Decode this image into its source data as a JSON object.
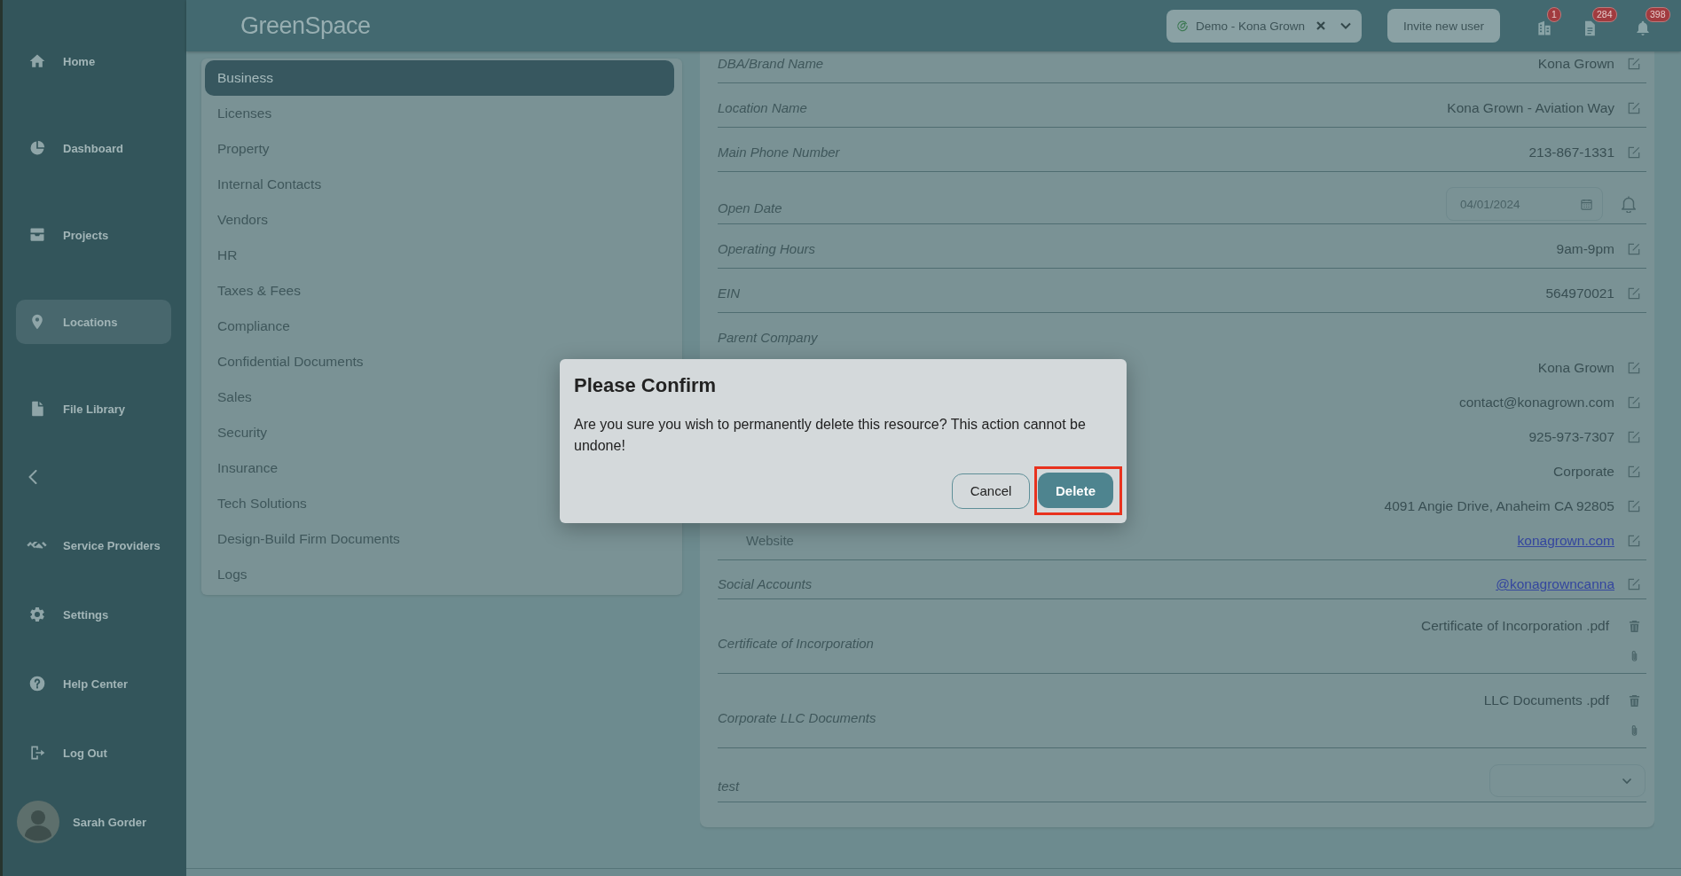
{
  "top_bar": {
    "logo": "GreenSpace",
    "account_selector": "Demo - Kona Grown",
    "invite_button": "Invite new user",
    "notifications": [
      {
        "count": "1"
      },
      {
        "count": "284"
      },
      {
        "count": "398"
      }
    ]
  },
  "sidebar": {
    "nav_items": [
      {
        "label": "Home",
        "selected": false
      },
      {
        "label": "Dashboard",
        "selected": false
      },
      {
        "label": "Projects",
        "selected": false
      },
      {
        "label": "Locations",
        "selected": true
      },
      {
        "label": "File Library",
        "selected": false
      }
    ],
    "bottom_items": [
      {
        "label": "Service Providers",
        "selected": false
      },
      {
        "label": "Settings",
        "selected": false
      },
      {
        "label": "Help Center",
        "selected": false
      },
      {
        "label": "Log Out",
        "selected": false
      }
    ],
    "user": {
      "name": "Sarah Gorder"
    }
  },
  "sections": {
    "items": [
      {
        "label": "Business",
        "selected": true
      },
      {
        "label": "Licenses",
        "selected": false
      },
      {
        "label": "Property",
        "selected": false
      },
      {
        "label": "Internal Contacts",
        "selected": false
      },
      {
        "label": "Vendors",
        "selected": false
      },
      {
        "label": "HR",
        "selected": false
      },
      {
        "label": "Taxes & Fees",
        "selected": false
      },
      {
        "label": "Compliance",
        "selected": false
      },
      {
        "label": "Confidential Documents",
        "selected": false
      },
      {
        "label": "Sales",
        "selected": false
      },
      {
        "label": "Security",
        "selected": false
      },
      {
        "label": "Insurance",
        "selected": false
      },
      {
        "label": "Tech Solutions",
        "selected": false
      },
      {
        "label": "Design-Build Firm Documents",
        "selected": false
      },
      {
        "label": "Logs",
        "selected": false
      }
    ]
  },
  "details": {
    "rows": [
      {
        "kind": "text",
        "label": "DBA/Brand Name",
        "value": "Kona Grown"
      },
      {
        "kind": "text",
        "label": "Location Name",
        "value": "Kona Grown - Aviation Way"
      },
      {
        "kind": "text",
        "label": "Main Phone Number",
        "value": "213-867-1331"
      },
      {
        "kind": "date",
        "label": "Open Date",
        "value": "04/01/2024"
      },
      {
        "kind": "text",
        "label": "Operating Hours",
        "value": "9am-9pm"
      },
      {
        "kind": "text",
        "label": "EIN",
        "value": "564970021"
      },
      {
        "kind": "group",
        "label": "Parent Company",
        "children": [
          {
            "kind": "text",
            "value": "Kona Grown"
          },
          {
            "kind": "text",
            "value": "contact@konagrown.com"
          },
          {
            "kind": "text",
            "value": "925-973-7307"
          },
          {
            "kind": "text",
            "value": "Corporate"
          },
          {
            "kind": "text",
            "value": "4091 Angie Drive, Anaheim CA 92805"
          },
          {
            "kind": "link",
            "label": "Website",
            "value": "konagrown.com"
          }
        ]
      },
      {
        "kind": "link",
        "label": "Social Accounts",
        "value": "@konagrowncanna"
      },
      {
        "kind": "file",
        "label": "Certificate of Incorporation",
        "value": "Certificate of Incorporation .pdf"
      },
      {
        "kind": "file",
        "label": "Corporate LLC Documents",
        "value": "LLC Documents .pdf"
      },
      {
        "kind": "select",
        "label": "test"
      }
    ]
  },
  "dialog": {
    "title": "Please Confirm",
    "message": "Are you sure you wish to permanently delete this resource? This action cannot be undone!",
    "buttons": [
      {
        "label": "Cancel",
        "kind": "secondary",
        "highlighted": false
      },
      {
        "label": "Delete",
        "kind": "primary",
        "highlighted": true
      }
    ]
  }
}
